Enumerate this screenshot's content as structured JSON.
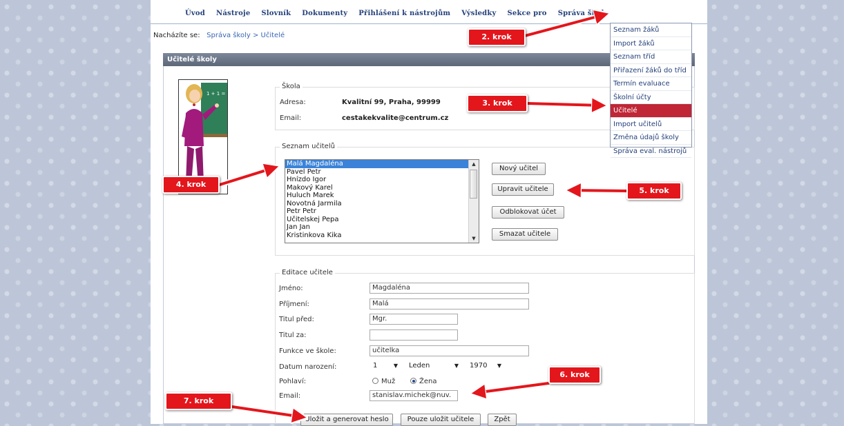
{
  "nav": {
    "items": [
      "Úvod",
      "Nástroje",
      "Slovník",
      "Dokumenty",
      "Přihlášení k nástrojům",
      "Výsledky",
      "Sekce pro",
      "Správa školy"
    ],
    "active_index": 7
  },
  "breadcrumb": {
    "label": "Nacházíte se:",
    "path1": "Správa školy",
    "separator": ">",
    "path2": "Učitelé"
  },
  "panel_title": "Učitelé školy",
  "teacher_board_text": "1 + 1 = 2",
  "school": {
    "legend": "Škola",
    "address_label": "Adresa:",
    "address_value": "Kvalitní 99, Praha, 99999",
    "email_label": "Email:",
    "email_value": "cestakekvalite@centrum.cz"
  },
  "teachers": {
    "legend": "Seznam učitelů",
    "items": [
      "Malá Magdaléna",
      "Pavel Petr",
      "Hnízdo Igor",
      "Makový Karel",
      "Huluch Marek",
      "Novotná Jarmila",
      "Petr Petr",
      "Učitelskej Pepa",
      "Jan Jan",
      "Kristinkova Kika"
    ],
    "selected_index": 0,
    "buttons": {
      "new": "Nový učitel",
      "edit": "Upravit učitele",
      "unblock": "Odblokovat účet",
      "delete": "Smazat učitele"
    }
  },
  "edit": {
    "legend": "Editace učitele",
    "first_name_label": "Jméno:",
    "first_name": "Magdaléna",
    "last_name_label": "Příjmení:",
    "last_name": "Malá",
    "title_before_label": "Titul před:",
    "title_before": "Mgr.",
    "title_after_label": "Titul za:",
    "title_after": "",
    "function_label": "Funkce ve škole:",
    "function": "učitelka",
    "birth_label": "Datum narození:",
    "birth_day": "1",
    "birth_month": "Leden",
    "birth_year": "1970",
    "gender_label": "Pohlaví:",
    "gender_male": "Muž",
    "gender_female": "Žena",
    "gender_selected": "female",
    "email_label": "Email:",
    "email": "stanislav.michek@nuv.",
    "save_generate": "Uložit a generovat heslo",
    "save_only": "Pouze uložit učitele",
    "back": "Zpět"
  },
  "dropdown": {
    "items": [
      "Seznam žáků",
      "Import žáků",
      "Seznam tříd",
      "Přiřazení žáků do tříd",
      "Termín evaluace",
      "Školní účty",
      "Učitelé",
      "Import učitelů",
      "Změna údajů školy",
      "Správa eval. nástrojů"
    ],
    "active_index": 6
  },
  "callouts": [
    "2. krok",
    "3. krok",
    "4. krok",
    "5. krok",
    "6. krok",
    "7. krok"
  ],
  "colors": {
    "callout": "#e3161c",
    "nav": "#24407a",
    "menu_active": "#c02636",
    "list_selected": "#3a83d9"
  }
}
